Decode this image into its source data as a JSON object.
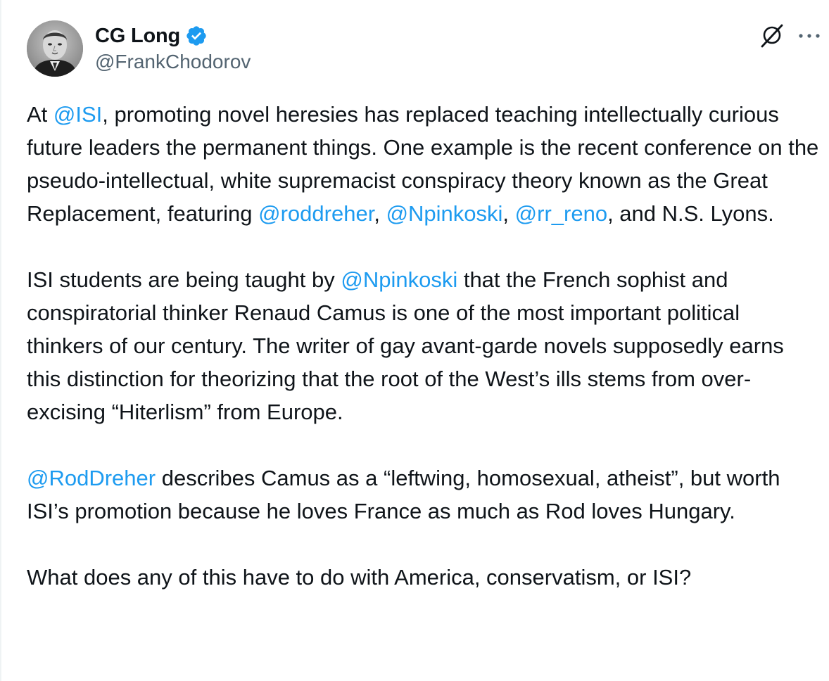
{
  "author": {
    "display_name": "CG Long",
    "handle": "@FrankChodorov",
    "verified": true,
    "avatar_icon": "portrait-avatar"
  },
  "header_actions": {
    "grok_icon": "grok-icon",
    "more_icon": "more-options-icon"
  },
  "colors": {
    "mention": "#1d9bf0",
    "verified_badge": "#1d9bf0",
    "text": "#0f1419",
    "secondary": "#536471"
  },
  "tweet": {
    "p1": {
      "s1": "At ",
      "m1": "@ISI",
      "s2": ", promoting novel heresies has replaced teaching intellectually curious future leaders the permanent things. One example is the recent conference on the pseudo-intellectual, white supremacist conspiracy theory known as the Great Replacement, featuring ",
      "m2": "@roddreher",
      "s3": ", ",
      "m3": "@Npinkoski",
      "s4": ", ",
      "m4": "@rr_reno",
      "s5": ", and N.S. Lyons."
    },
    "p2": {
      "s1": "ISI students are being taught by ",
      "m1": "@Npinkoski",
      "s2": " that the French sophist and conspiratorial thinker Renaud Camus is one of the most important political thinkers of our century. The writer of gay avant-garde novels supposedly earns this distinction for theorizing that the root of the West’s ills stems from over-excising “Hiterlism” from Europe."
    },
    "p3": {
      "m1": "@RodDreher",
      "s1": " describes Camus as a “leftwing, homosexual, atheist”, but worth ISI’s promotion because he loves France as much as Rod loves Hungary."
    },
    "p4": {
      "s1": "What does any of this have to do with America, conservatism, or ISI?"
    }
  }
}
